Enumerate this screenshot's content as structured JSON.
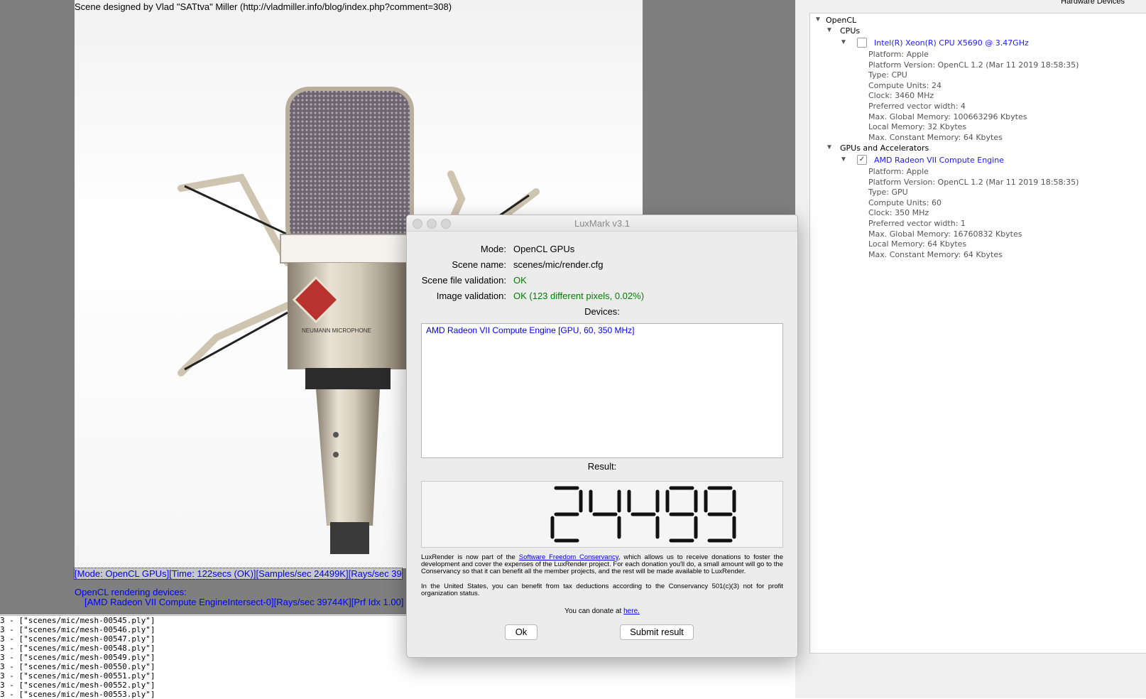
{
  "render": {
    "scene_credit": "Scene designed by Vlad \"SATtva\" Miller (http://vladmiller.info/blog/index.php?comment=308)",
    "status_line": "[Mode: OpenCL GPUs][Time: 122secs (OK)][Samples/sec  24499K][Rays/sec  39",
    "devices_title": "OpenCL rendering devices:",
    "devices_line": "[AMD Radeon VII Compute EngineIntersect-0][Rays/sec  39744K][Prf Idx 1.00]"
  },
  "log": [
    "3 -  [\"scenes/mic/mesh-00545.ply\"]",
    "3 -  [\"scenes/mic/mesh-00546.ply\"]",
    "3 -  [\"scenes/mic/mesh-00547.ply\"]",
    "3 -  [\"scenes/mic/mesh-00548.ply\"]",
    "3 -  [\"scenes/mic/mesh-00549.ply\"]",
    "3 -  [\"scenes/mic/mesh-00550.ply\"]",
    "3 -  [\"scenes/mic/mesh-00551.ply\"]",
    "3 -  [\"scenes/mic/mesh-00552.ply\"]",
    "3 -  [\"scenes/mic/mesh-00553.ply\"]"
  ],
  "hardware": {
    "header": "Hardware Devices",
    "root": "OpenCL",
    "cpus_label": "CPUs",
    "cpu_name": "Intel(R) Xeon(R) CPU          X5690  @ 3.47GHz",
    "cpu_checked": false,
    "cpu_props": [
      "Platform: Apple",
      "Platform Version: OpenCL 1.2 (Mar 11 2019 18:58:35)",
      "Type: CPU",
      "Compute Units: 24",
      "Clock: 3460 MHz",
      "Preferred vector width: 4",
      "Max. Global Memory: 100663296 Kbytes",
      "Local Memory: 32 Kbytes",
      "Max. Constant Memory: 64 Kbytes"
    ],
    "gpus_label": "GPUs and Accelerators",
    "gpu_name": "AMD Radeon VII Compute Engine",
    "gpu_checked": true,
    "gpu_props": [
      "Platform: Apple",
      "Platform Version: OpenCL 1.2 (Mar 11 2019 18:58:35)",
      "Type: GPU",
      "Compute Units: 60",
      "Clock: 350 MHz",
      "Preferred vector width: 1",
      "Max. Global Memory: 16760832 Kbytes",
      "Local Memory: 64 Kbytes",
      "Max. Constant Memory: 64 Kbytes"
    ]
  },
  "dialog": {
    "title": "LuxMark v3.1",
    "mode_label": "Mode:",
    "mode_value": "OpenCL GPUs",
    "scene_label": "Scene name:",
    "scene_value": "scenes/mic/render.cfg",
    "scene_val_label": "Scene file validation:",
    "scene_val_value": "OK",
    "image_val_label": "Image validation:",
    "image_val_value": "OK (123 different pixels, 0.02%)",
    "devices_label": "Devices:",
    "devices": [
      "AMD Radeon VII Compute Engine [GPU, 60, 350 MHz]"
    ],
    "result_label": "Result:",
    "result_value": "24499",
    "donate_p1_a": "LuxRender is now part of the ",
    "donate_link": "Software Freedom Conservancy",
    "donate_p1_b": ", which allows us to receive donations to foster the development and cover the expenses of the LuxRender project. For each donation you'll do, a small amount will go to the Conservancy so that it can benefit all the member projects, and the rest will be made available to LuxRender.",
    "donate_p2": "In the United States, you can benefit from tax deductions according to the Conservancy 501(c)(3) not for profit organization status.",
    "donate_line": "You can donate at ",
    "donate_here": "here.",
    "ok_label": "Ok",
    "submit_label": "Submit result"
  }
}
